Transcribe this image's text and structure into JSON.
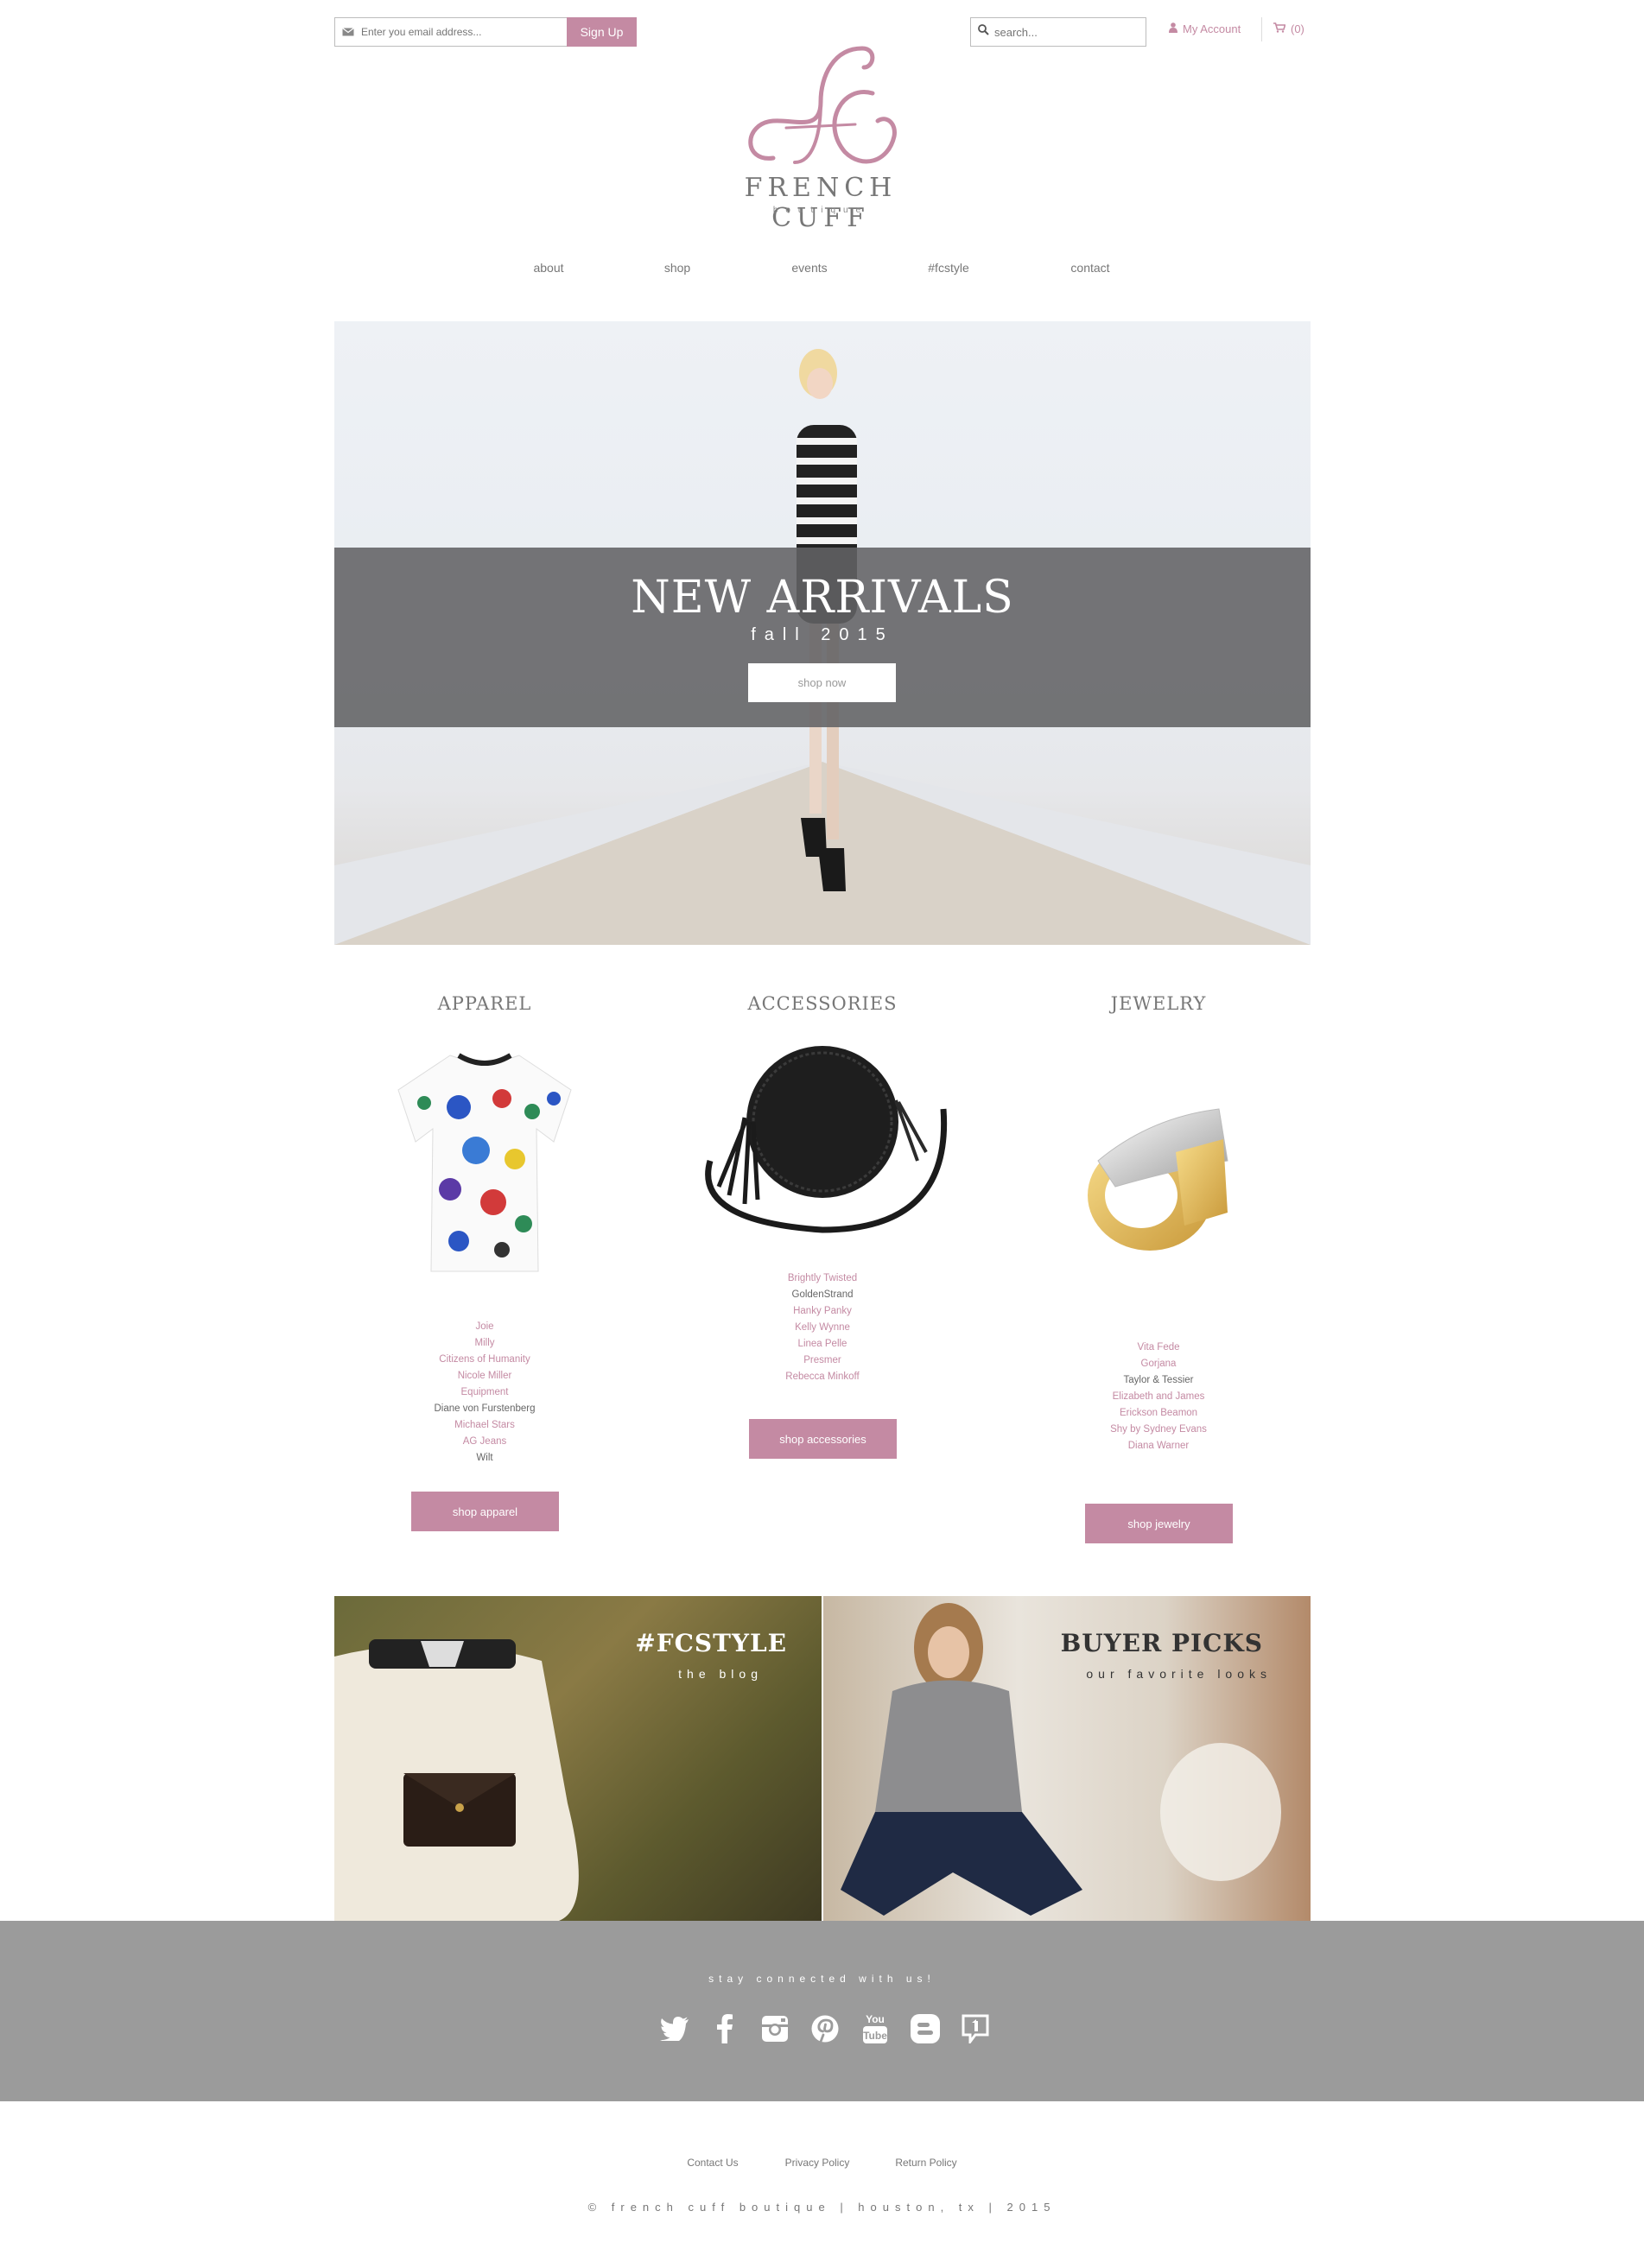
{
  "header": {
    "email_placeholder": "Enter you email address...",
    "signup_label": "Sign Up",
    "search_placeholder": "search...",
    "account_label": "My Account",
    "cart_label": "(0)"
  },
  "logo": {
    "monogram": "fc",
    "name": "FRENCH CUFF",
    "sub": "boutique"
  },
  "nav": {
    "items": [
      {
        "label": "about"
      },
      {
        "label": "shop"
      },
      {
        "label": "events"
      },
      {
        "label": "#fcstyle"
      },
      {
        "label": "contact"
      }
    ]
  },
  "hero": {
    "title": "NEW ARRIVALS",
    "subtitle": "fall 2015",
    "button_label": "shop now"
  },
  "categories": [
    {
      "title": "APPAREL",
      "brands": [
        "Joie",
        "Milly",
        "Citizens of Humanity",
        "Nicole Miller",
        "Equipment",
        "Diane von Furstenberg",
        "Michael Stars",
        "AG Jeans",
        "Wilt"
      ],
      "button_label": "shop apparel"
    },
    {
      "title": "ACCESSORIES",
      "brands": [
        "Brightly Twisted",
        "GoldenStrand",
        "Hanky Panky",
        "Kelly Wynne",
        "Linea Pelle",
        "Presmer",
        "Rebecca Minkoff"
      ],
      "button_label": "shop accessories"
    },
    {
      "title": "JEWELRY",
      "brands": [
        "Vita Fede",
        "Gorjana",
        "Taylor & Tessier",
        "Elizabeth and James",
        "Erickson Beamon",
        "Shy by Sydney Evans",
        "Diana Warner"
      ],
      "button_label": "shop jewelry"
    }
  ],
  "promos": [
    {
      "title": "#FCSTYLE",
      "subtitle": "the blog"
    },
    {
      "title": "BUYER PICKS",
      "subtitle": "our favorite looks"
    }
  ],
  "connect": {
    "title": "stay connected with us!",
    "icons": [
      "twitter-icon",
      "facebook-icon",
      "instagram-icon",
      "pinterest-icon",
      "youtube-icon",
      "blogger-icon",
      "bloglovin-icon"
    ]
  },
  "footer": {
    "links": [
      "Contact Us",
      "Privacy Policy",
      "Return Policy"
    ],
    "copyright": "© french cuff boutique | houston, tx | 2015"
  },
  "colors": {
    "accent": "#c48aa3",
    "band_gray": "#9b9b9b",
    "hero_band": "#626264"
  }
}
